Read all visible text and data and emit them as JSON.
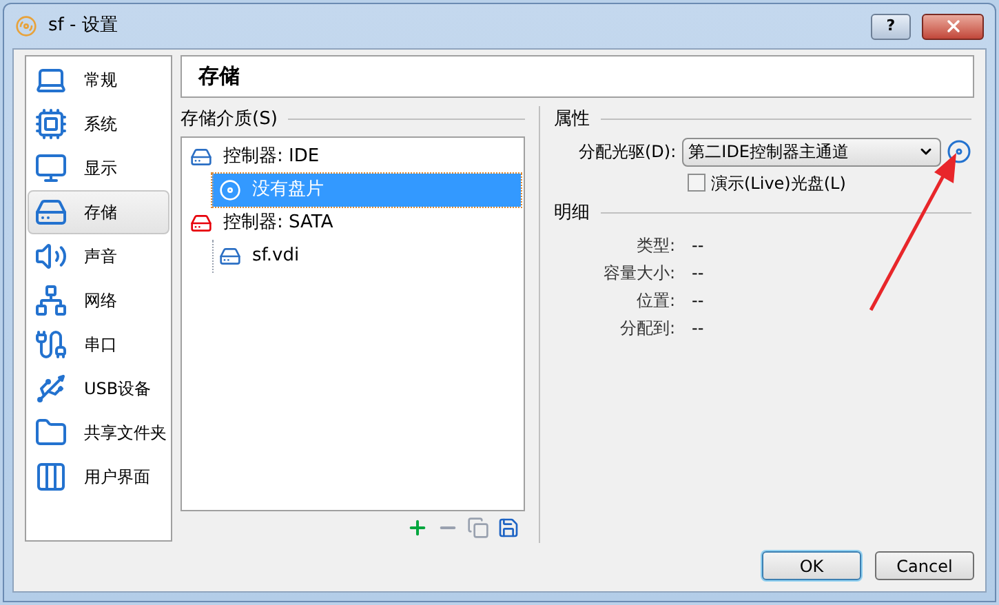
{
  "window": {
    "title": "sf - 设置",
    "buttons": [
      "?"
    ]
  },
  "sidebar": {
    "items": [
      {
        "label": "常规",
        "selected": false
      },
      {
        "label": "系统",
        "selected": false
      },
      {
        "label": "显示",
        "selected": false
      },
      {
        "label": "存储",
        "selected": true
      },
      {
        "label": "声音",
        "selected": false
      },
      {
        "label": "网络",
        "selected": false
      },
      {
        "label": "串口",
        "selected": false
      },
      {
        "label": "USB设备",
        "selected": false
      },
      {
        "label": "共享文件夹",
        "selected": false
      },
      {
        "label": "用户界面",
        "selected": false
      }
    ]
  },
  "page_title": "存储",
  "storage": {
    "heading": "存储介质(S)",
    "tree": [
      {
        "label": "控制器: IDE",
        "kind": "controller",
        "selected": false,
        "children": [
          {
            "label": "没有盘片",
            "kind": "optical",
            "selected": true
          }
        ]
      },
      {
        "label": "控制器: SATA",
        "kind": "sata",
        "selected": false,
        "children": [
          {
            "label": "sf.vdi",
            "kind": "disk",
            "selected": false
          }
        ]
      }
    ]
  },
  "attributes": {
    "heading": "属性",
    "drive_label": "分配光驱(D):",
    "drive_value": "第二IDE控制器主通道",
    "live_label": "演示(Live)光盘(L)",
    "live_checked": false
  },
  "details": {
    "heading": "明细",
    "rows": [
      {
        "label": "类型:",
        "value": "--"
      },
      {
        "label": "容量大小:",
        "value": "--"
      },
      {
        "label": "位置:",
        "value": "--"
      },
      {
        "label": "分配到:",
        "value": "--"
      }
    ]
  },
  "buttons": [
    {
      "label": "OK",
      "default": true
    },
    {
      "label": "Cancel",
      "default": false
    }
  ]
}
